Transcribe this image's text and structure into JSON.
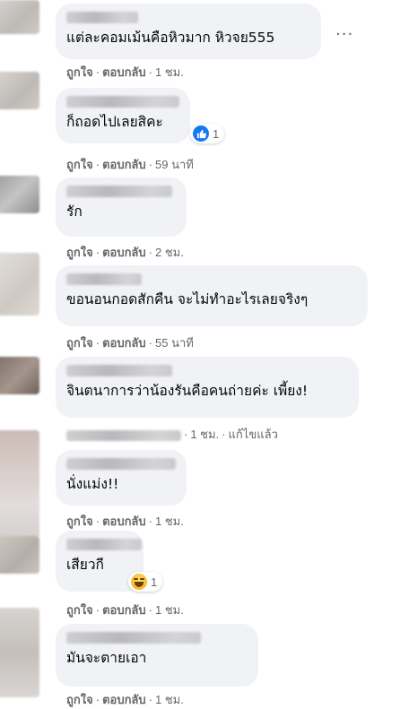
{
  "comments": [
    {
      "text": "แต่ละคอมเม้นคือหิวมาก หิวจย555",
      "actions": {
        "like": "ถูกใจ",
        "reply": "ตอบกลับ",
        "time": "1 ชม."
      }
    },
    {
      "text": "ก็ถอดไปเลยสิคะ",
      "reaction": {
        "icon": "like-icon",
        "count": "1"
      },
      "actions": {
        "like": "ถูกใจ",
        "reply": "ตอบกลับ",
        "time": "59 นาที"
      }
    },
    {
      "text": "รัก",
      "actions": {
        "like": "ถูกใจ",
        "reply": "ตอบกลับ",
        "time": "2 ชม."
      }
    },
    {
      "text": "ขอนอนกอดสักคืน จะไม่ทำอะไรเลยจริงๆ",
      "actions": {
        "like": "ถูกใจ",
        "reply": "ตอบกลับ",
        "time": "55 นาที"
      }
    },
    {
      "text": "จินตนาการว่าน้องรันคือคนถ่ายค่ะ เพี้ยง!",
      "actions": {
        "time": "1 ชม.",
        "edited": "แก้ไขแล้ว"
      }
    },
    {
      "text": "นั่งแม่ง!!",
      "actions": {
        "like": "ถูกใจ",
        "reply": "ตอบกลับ",
        "time": "1 ชม."
      }
    },
    {
      "text": "เสียวกี",
      "reaction": {
        "icon": "haha-icon",
        "count": "1"
      },
      "actions": {
        "like": "ถูกใจ",
        "reply": "ตอบกลับ",
        "time": "1 ชม."
      }
    },
    {
      "text": "มันจะตายเอา",
      "actions": {
        "like": "ถูกใจ",
        "reply": "ตอบกลับ",
        "time": "1 ชม."
      }
    }
  ],
  "more_options": "···",
  "colors": {
    "bubble": "#f0f2f5",
    "meta": "#65676b",
    "like_blue": "#1877f2"
  }
}
